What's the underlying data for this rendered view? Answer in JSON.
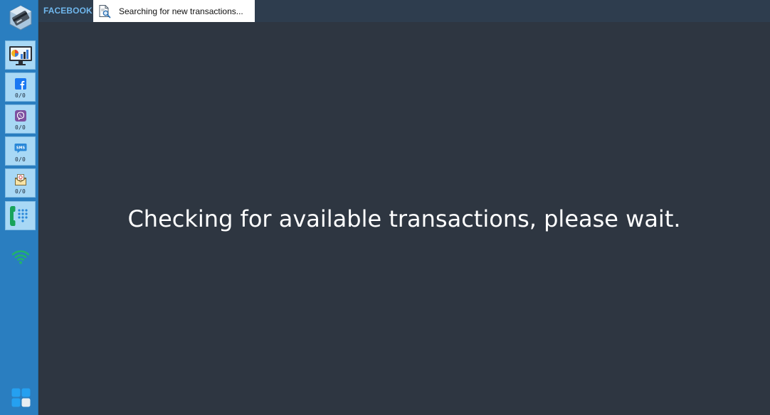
{
  "app": {
    "channel_label": "FACEBOOK",
    "status_tab_text": "Searching for new transactions...",
    "main_message": "Checking for available transactions, please wait."
  },
  "sidebar": {
    "items": [
      {
        "icon": "dashboard-icon"
      },
      {
        "icon": "facebook-icon",
        "count": "0/0"
      },
      {
        "icon": "viber-icon",
        "count": "0/0"
      },
      {
        "icon": "sms-icon",
        "count": "0/0"
      },
      {
        "icon": "email-icon",
        "count": "0/0"
      },
      {
        "icon": "phone-icon"
      }
    ],
    "status_icon": "wifi-icon",
    "bottom_icon": "apps-grid-icon"
  },
  "colors": {
    "sidebar_bg": "#2a7ec0",
    "button_bg": "#a8d8f5",
    "main_bg": "#2e3641",
    "topbar_bg": "#2e3d4e",
    "accent_label": "#6fb6ec",
    "wifi_green": "#21b36b"
  }
}
